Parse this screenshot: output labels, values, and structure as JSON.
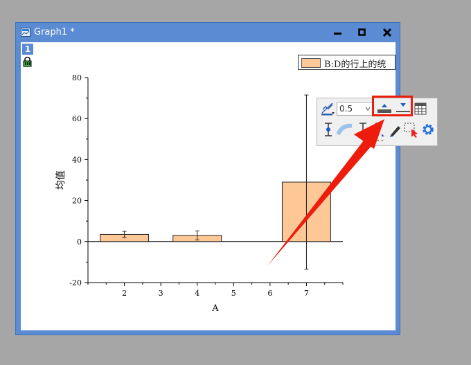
{
  "window": {
    "title": "Graph1 *",
    "layer_number": "1"
  },
  "legend": {
    "label": "B:D的行上的统"
  },
  "mini_toolbar": {
    "line_width_value": "0.5",
    "items": [
      "plot-settings-icon",
      "line-width-combo",
      "increase-width-icon",
      "decrease-width-icon",
      "table-icon",
      "error-bar-icon",
      "smooth-icon",
      "cap-width-icon",
      "cap-down-icon",
      "pen-icon",
      "select-icon",
      "gear-icon"
    ]
  },
  "chart_data": {
    "type": "bar",
    "x": [
      2,
      4,
      7
    ],
    "values": [
      3.5,
      3,
      29
    ],
    "error": [
      1.5,
      2.2,
      42.5
    ],
    "xlabel": "A",
    "ylabel": "均值",
    "xlim": [
      1,
      8
    ],
    "ylim": [
      -20,
      80
    ],
    "xticks": [
      "2",
      "3",
      "4",
      "5",
      "6",
      "7"
    ],
    "yticks": [
      "-20",
      "0",
      "20",
      "40",
      "60",
      "80"
    ],
    "bar_color": "#fdc896"
  },
  "colors": {
    "window_frame": "#5b8bd2",
    "highlight": "#ee1c0c"
  }
}
